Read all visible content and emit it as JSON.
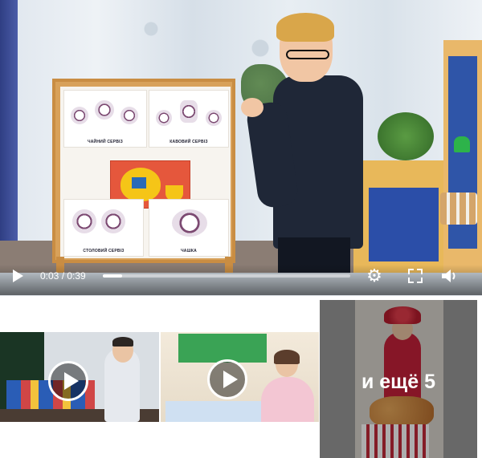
{
  "player": {
    "time_current": "0:03",
    "time_separator": " / ",
    "time_total": "0:39",
    "progress": 0.077,
    "icons": {
      "play": "play-icon",
      "settings": "gear-icon",
      "fullscreen": "fullscreen-icon",
      "volume": "volume-icon"
    }
  },
  "poster": {
    "card_tea": "ЧАЙНИЙ СЕРВІЗ",
    "card_coffee": "КАВОВИЙ СЕРВІЗ",
    "card_table": "СТОЛОВИЙ СЕРВІЗ",
    "card_cup": "ЧАШКА"
  },
  "gallery": {
    "more_label": "и ещё 5"
  },
  "colors": {
    "shelf_blue": "#2b4ea8",
    "easel_wood": "#d8a15a",
    "overlay_white": "#ffffff"
  }
}
